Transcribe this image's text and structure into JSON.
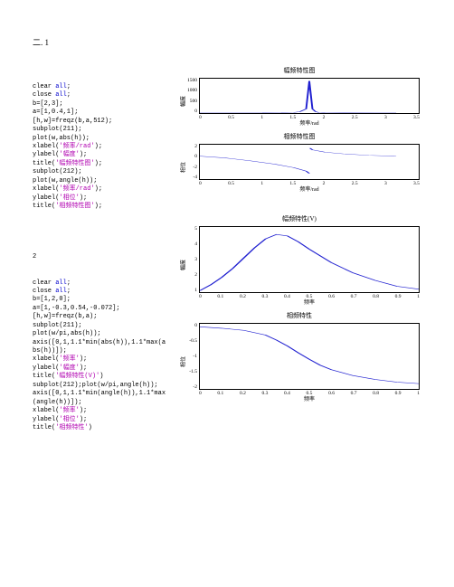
{
  "section_header": "二. 1",
  "code1": [
    {
      "t": "clear ",
      "c": ""
    },
    {
      "t": "all",
      "c": "kw"
    },
    {
      "t": ";\n",
      "c": ""
    },
    {
      "t": "close ",
      "c": ""
    },
    {
      "t": "all",
      "c": "kw"
    },
    {
      "t": ";\n",
      "c": ""
    },
    {
      "t": "b=[2,3];\na=[1,0.4,1];\n[h,w]=freqz(b,a,512);\nsubplot(211);\nplot(w,abs(h));\nxlabel(",
      "c": ""
    },
    {
      "t": "'频率/rad'",
      "c": "str"
    },
    {
      "t": ");\nylabel(",
      "c": ""
    },
    {
      "t": "'幅度'",
      "c": "str"
    },
    {
      "t": ");\ntitle(",
      "c": ""
    },
    {
      "t": "'幅频特性图'",
      "c": "str"
    },
    {
      "t": ");\nsubplot(212);\nplot(w,angle(h));\nxlabel(",
      "c": ""
    },
    {
      "t": "'频率/rad'",
      "c": "str"
    },
    {
      "t": ");\nylabel(",
      "c": ""
    },
    {
      "t": "'相位'",
      "c": "str"
    },
    {
      "t": ");\ntitle(",
      "c": ""
    },
    {
      "t": "'相频特性图'",
      "c": "str"
    },
    {
      "t": ");",
      "c": ""
    }
  ],
  "code2_header": "2",
  "code2": [
    {
      "t": "clear ",
      "c": ""
    },
    {
      "t": "all",
      "c": "kw"
    },
    {
      "t": ";\n",
      "c": ""
    },
    {
      "t": "close ",
      "c": ""
    },
    {
      "t": "all",
      "c": "kw"
    },
    {
      "t": ";\n",
      "c": ""
    },
    {
      "t": "b=[1,2,0];\na=[1,-0.3,0.54,-0.072];\n[h,w]=freqz(b,a);\nsubplot(211);\nplot(w/pi,abs(h));\naxis([0,1,1.1*min(abs(h)),1.1*max(abs(h))]);\nxlabel(",
      "c": ""
    },
    {
      "t": "'频率'",
      "c": "str"
    },
    {
      "t": ");\nylabel(",
      "c": ""
    },
    {
      "t": "'幅度'",
      "c": "str"
    },
    {
      "t": ");\ntitle(",
      "c": ""
    },
    {
      "t": "'幅频特性(V)'",
      "c": "str"
    },
    {
      "t": ")\nsubplot(212);plot(w/pi,angle(h));\naxis([0,1,1.1*min(angle(h)),1.1*max(angle(h))]);\nxlabel(",
      "c": ""
    },
    {
      "t": "'频率'",
      "c": "str"
    },
    {
      "t": ");\nylabel(",
      "c": ""
    },
    {
      "t": "'相位'",
      "c": "str"
    },
    {
      "t": ");\ntitle(",
      "c": ""
    },
    {
      "t": "'相频特性'",
      "c": "str"
    },
    {
      "t": ")",
      "c": ""
    }
  ],
  "chart1": {
    "title": "幅频特性图",
    "ylabel": "幅度",
    "xlabel": "频率/rad",
    "yticks": [
      "1500",
      "1000",
      "500",
      "0"
    ],
    "xticks": [
      "0",
      "0.5",
      "1",
      "1.5",
      "2",
      "2.5",
      "3",
      "3.5"
    ]
  },
  "chart2": {
    "title": "相频特性图",
    "ylabel": "相位",
    "xlabel": "频率/rad",
    "yticks": [
      "2",
      "0",
      "-2",
      "-4"
    ],
    "xticks": [
      "0",
      "0.5",
      "1",
      "1.5",
      "2",
      "2.5",
      "3",
      "3.5"
    ]
  },
  "chart3": {
    "title": "幅频特性(V)",
    "ylabel": "幅度",
    "xlabel": "频率",
    "yticks": [
      "5",
      "4",
      "3",
      "2",
      "1"
    ],
    "xticks": [
      "0",
      "0.1",
      "0.2",
      "0.3",
      "0.4",
      "0.5",
      "0.6",
      "0.7",
      "0.8",
      "0.9",
      "1"
    ]
  },
  "chart4": {
    "title": "相频特性",
    "ylabel": "相位",
    "xlabel": "频率",
    "yticks": [
      "0",
      "-0.5",
      "-1",
      "-1.5",
      "-2"
    ],
    "xticks": [
      "0",
      "0.1",
      "0.2",
      "0.3",
      "0.4",
      "0.5",
      "0.6",
      "0.7",
      "0.8",
      "0.9",
      "1"
    ]
  },
  "chart_data": [
    {
      "type": "line",
      "title": "幅频特性图",
      "xlabel": "频率/rad",
      "ylabel": "幅度",
      "xlim": [
        0,
        3.5
      ],
      "ylim": [
        0,
        1500
      ],
      "x": [
        0,
        0.5,
        1.0,
        1.3,
        1.5,
        1.6,
        1.7,
        1.75,
        1.8,
        1.85,
        1.9,
        2.0,
        2.3,
        2.8,
        3.14
      ],
      "y": [
        5,
        6,
        8,
        12,
        25,
        60,
        180,
        1400,
        180,
        60,
        25,
        12,
        7,
        4,
        3
      ]
    },
    {
      "type": "line",
      "title": "相频特性图",
      "xlabel": "频率/rad",
      "ylabel": "相位",
      "xlim": [
        0,
        3.5
      ],
      "ylim": [
        -4,
        2
      ],
      "x": [
        0,
        0.4,
        0.8,
        1.2,
        1.5,
        1.7,
        1.75,
        1.76,
        1.8,
        2.0,
        2.3,
        2.7,
        3.1,
        3.14
      ],
      "y": [
        0,
        -0.3,
        -0.8,
        -1.4,
        -2.0,
        -2.6,
        -3.0,
        1.4,
        1.1,
        0.7,
        0.4,
        0.15,
        0.02,
        0
      ]
    },
    {
      "type": "line",
      "title": "幅频特性(V)",
      "xlabel": "频率",
      "ylabel": "幅度",
      "xlim": [
        0,
        1
      ],
      "ylim": [
        0.9,
        5.3
      ],
      "x": [
        0,
        0.05,
        0.1,
        0.15,
        0.2,
        0.25,
        0.3,
        0.35,
        0.4,
        0.45,
        0.5,
        0.6,
        0.7,
        0.8,
        0.9,
        1.0
      ],
      "y": [
        1.0,
        1.4,
        1.9,
        2.5,
        3.2,
        3.9,
        4.5,
        4.8,
        4.7,
        4.3,
        3.8,
        2.9,
        2.2,
        1.7,
        1.3,
        1.1
      ]
    },
    {
      "type": "line",
      "title": "相频特性",
      "xlabel": "频率",
      "ylabel": "相位",
      "xlim": [
        0,
        1
      ],
      "ylim": [
        -2.1,
        0.1
      ],
      "x": [
        0,
        0.1,
        0.2,
        0.3,
        0.35,
        0.4,
        0.45,
        0.5,
        0.55,
        0.6,
        0.7,
        0.8,
        0.9,
        1.0
      ],
      "y": [
        0,
        -0.05,
        -0.12,
        -0.28,
        -0.45,
        -0.65,
        -0.88,
        -1.1,
        -1.3,
        -1.45,
        -1.65,
        -1.78,
        -1.87,
        -1.92
      ]
    }
  ]
}
